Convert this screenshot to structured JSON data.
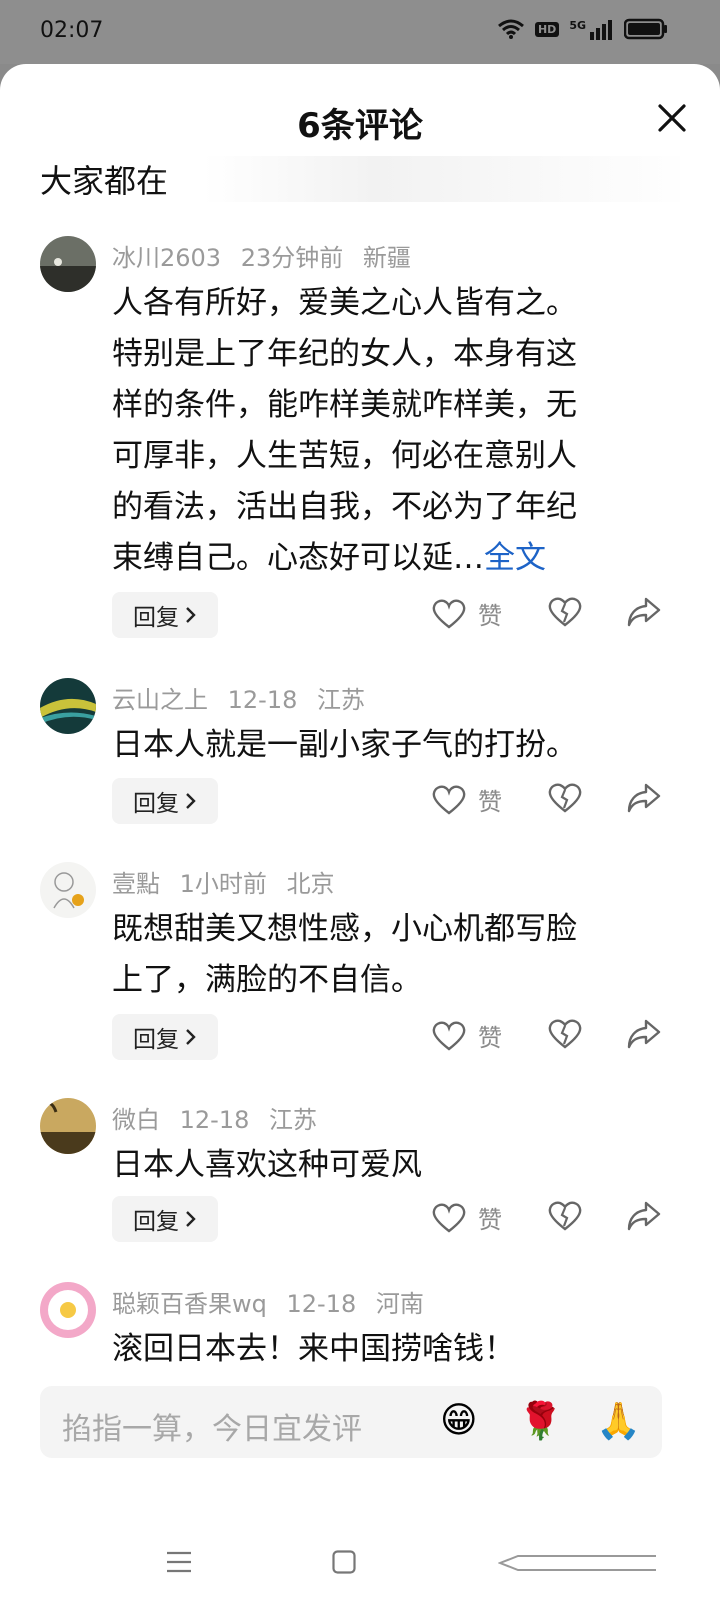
{
  "status_bar": {
    "time": "02:07",
    "hd_label": "HD",
    "network_label": "5G"
  },
  "sheet": {
    "title": "6条评论",
    "scroll_text": "大家都在"
  },
  "comments": [
    {
      "user": "冰川2603",
      "time": "23分钟前",
      "location": "新疆",
      "lines": [
        "人各有所好，爱美之心人皆有之。",
        "特别是上了年纪的女人，本身有这",
        "样的条件，能咋样美就咋样美，无",
        "可厚非，人生苦短，何必在意别人",
        "的看法，活出自我，不必为了年纪",
        "束缚自己。心态好可以延…"
      ],
      "full_text_label": "全文",
      "reply_label": "回复",
      "like_label": "赞"
    },
    {
      "user": "云山之上",
      "time": "12-18",
      "location": "江苏",
      "lines": [
        "日本人就是一副小家子气的打扮。"
      ],
      "reply_label": "回复",
      "like_label": "赞"
    },
    {
      "user": "壹點",
      "time": "1小时前",
      "location": "北京",
      "lines": [
        "既想甜美又想性感，小心机都写脸",
        "上了，满脸的不自信。"
      ],
      "reply_label": "回复",
      "like_label": "赞"
    },
    {
      "user": "微白",
      "time": "12-18",
      "location": "江苏",
      "lines": [
        "日本人喜欢这种可爱风"
      ],
      "reply_label": "回复",
      "like_label": "赞"
    },
    {
      "user": "聪颖百香果wq",
      "time": "12-18",
      "location": "河南",
      "lines": [
        "滚回日本去！来中国捞啥钱！"
      ]
    }
  ],
  "input": {
    "placeholder": "掐指一算，今日宜发评",
    "emojis": [
      "😁",
      "🌹",
      "🙏"
    ]
  },
  "colors": {
    "accent": "#1d63c7",
    "meta_text": "#9a9a9a",
    "sheet_bg": "#ffffff"
  }
}
